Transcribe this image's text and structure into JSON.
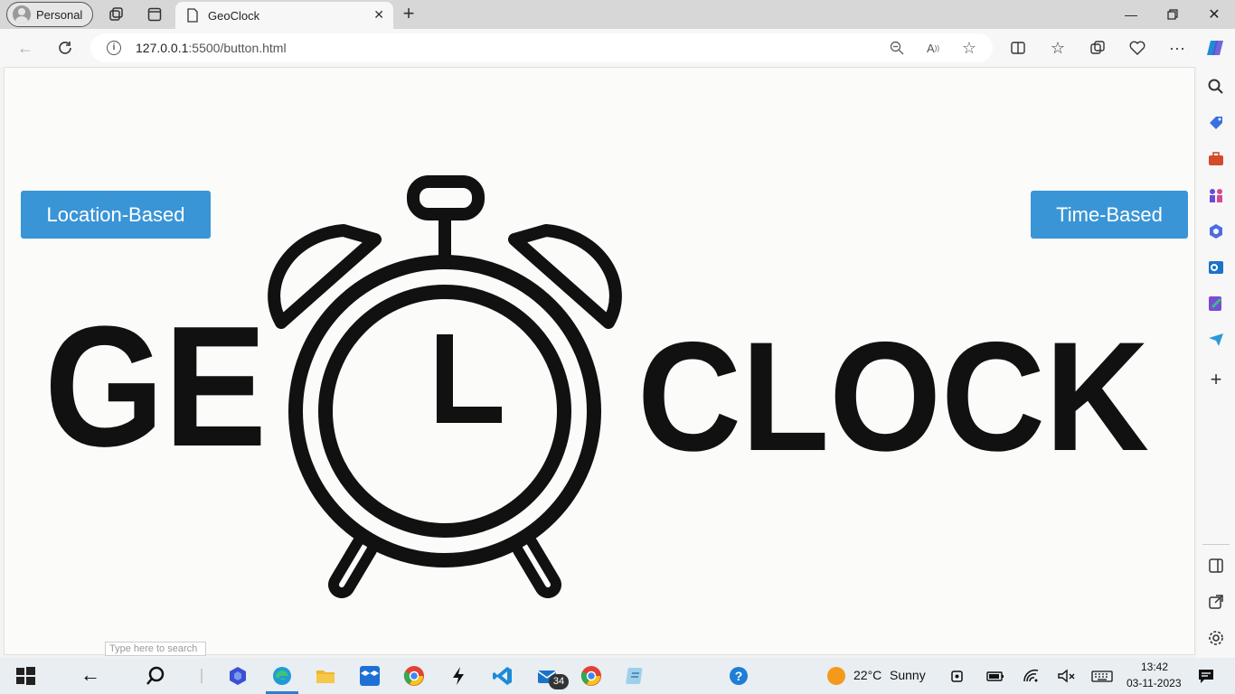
{
  "browser": {
    "profile_label": "Personal",
    "tab_title": "GeoClock",
    "url_host": "127.0.0.1",
    "url_path": ":5500/button.html"
  },
  "page": {
    "left_button": "Location-Based",
    "right_button": "Time-Based",
    "logo_left": "GE",
    "logo_right": "CLOCK",
    "search_hint": "Type here to search"
  },
  "taskbar": {
    "weather_temp": "22°C",
    "weather_desc": "Sunny",
    "mail_badge": "34",
    "time": "13:42",
    "date": "03-11-2023"
  },
  "colors": {
    "button_blue": "#3a95d6",
    "accent_blue": "#2d7dd2"
  }
}
